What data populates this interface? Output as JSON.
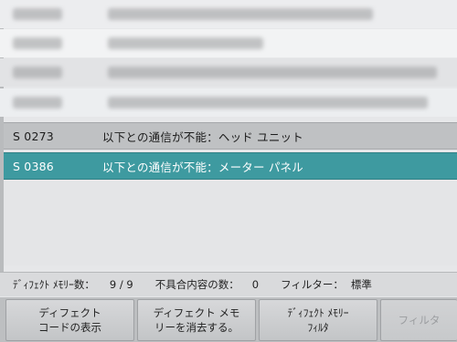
{
  "rows": [
    {
      "code": "S 0273",
      "description": "以下との通信が不能：ヘッド ユニット"
    },
    {
      "code": "S 0386",
      "description": "以下との通信が不能：メーター パネル"
    }
  ],
  "status_bar": {
    "defect_memory_count_label": "ﾃﾞｨﾌｪｸﾄ ﾒﾓﾘｰ数：",
    "defect_memory_count_value": "9 / 9",
    "fault_content_count_label": "不具合内容の数：",
    "fault_content_count_value": "0",
    "filter_label": "フィルター：",
    "filter_value": "標準"
  },
  "buttons": [
    {
      "line1": "ディフェクト",
      "line2": "コードの表示"
    },
    {
      "line1": "ディフェクト メモ",
      "line2": "リーを消去する。"
    },
    {
      "line1": "ﾃﾞｨﾌｪｸﾄ ﾒﾓﾘｰ",
      "line2": "ﾌｨﾙﾀ"
    },
    {
      "line1": "フィルタ",
      "line2": ""
    }
  ],
  "colors": {
    "selected_row": "#3e9aa0",
    "highlight_row": "#bfc1c3"
  }
}
